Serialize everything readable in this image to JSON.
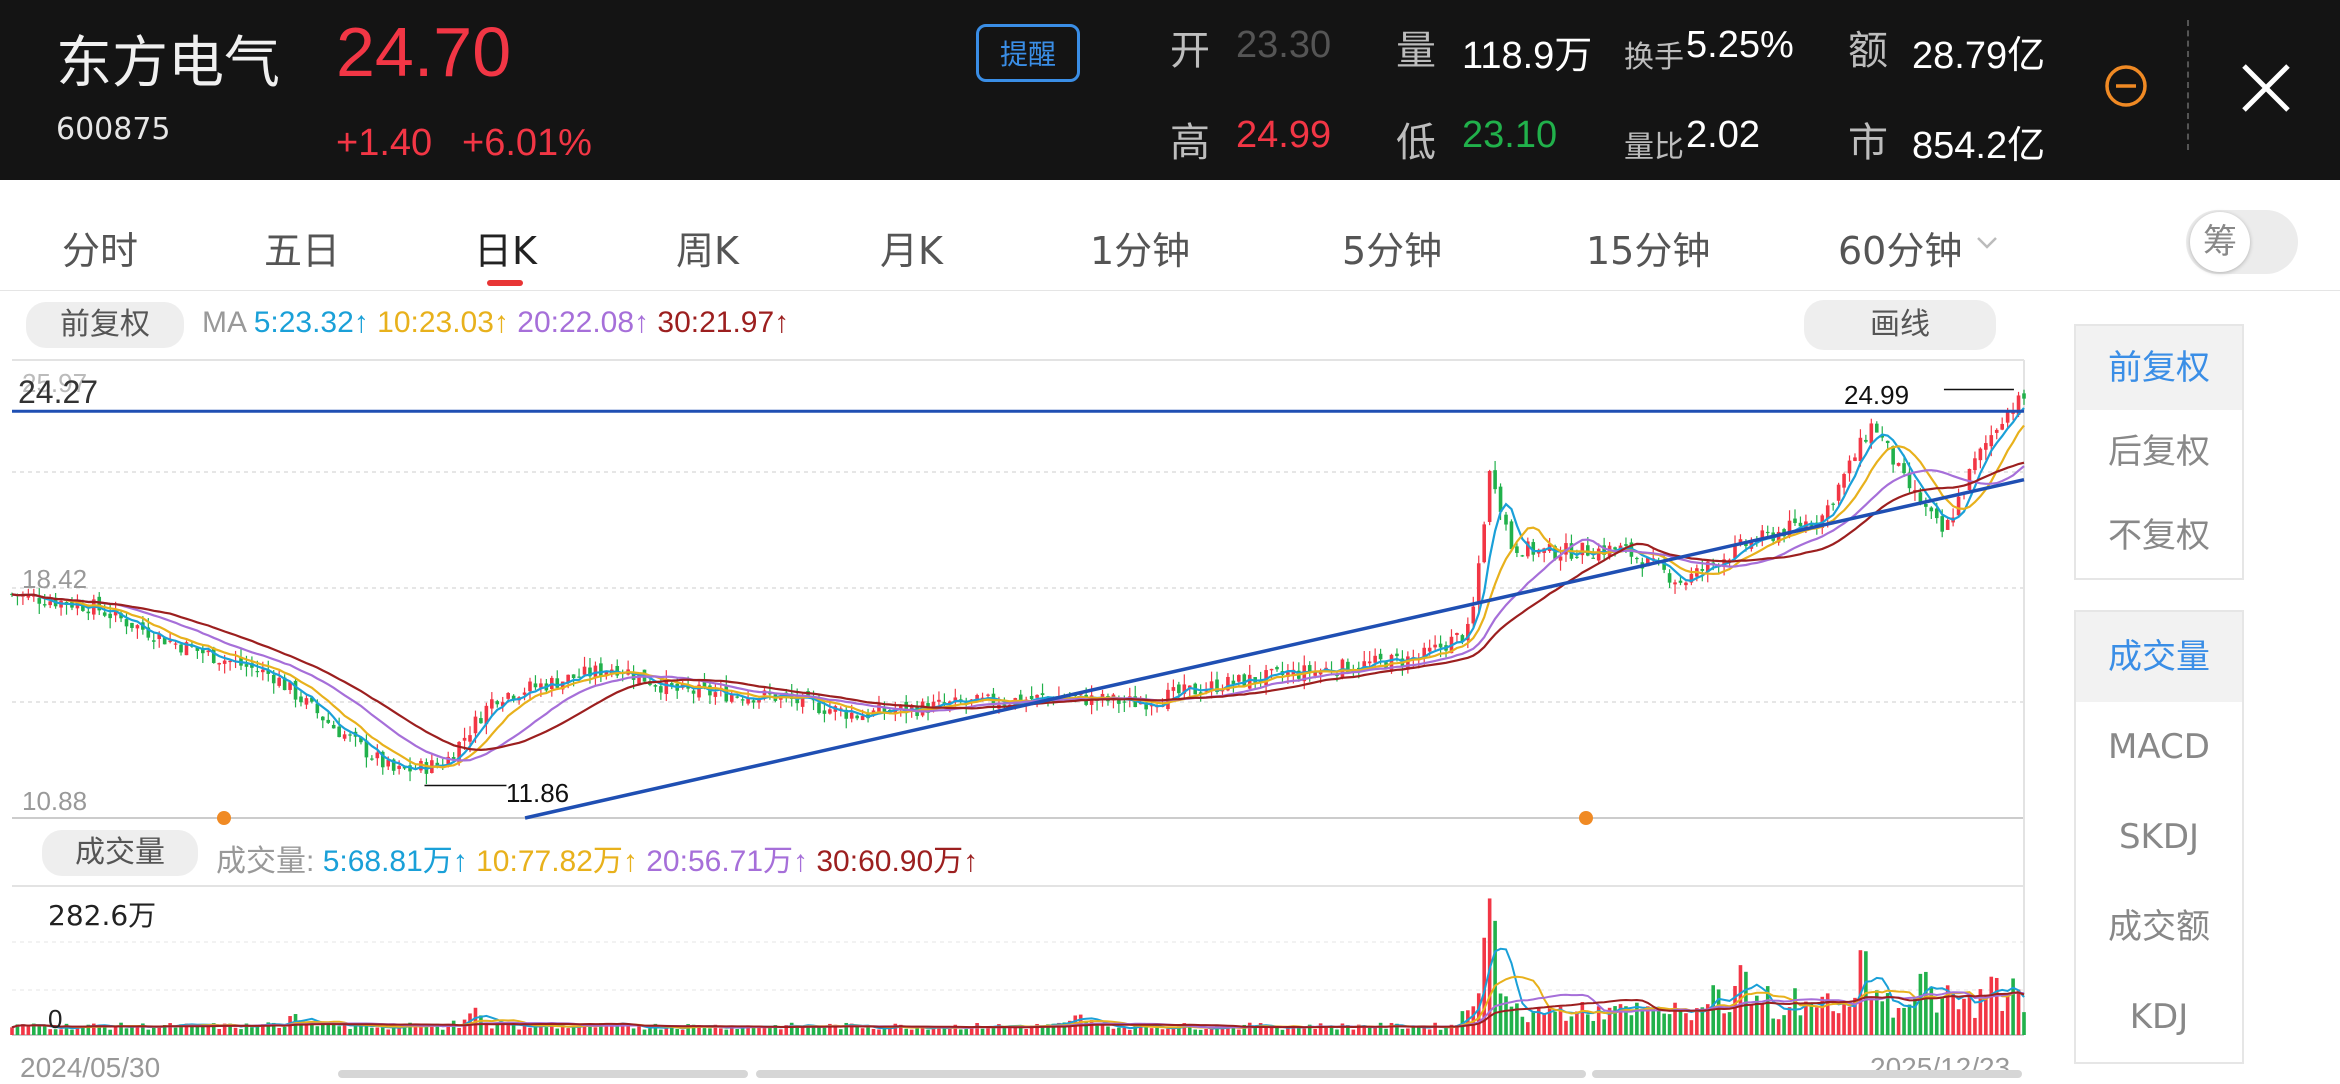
{
  "header": {
    "name": "东方电气",
    "code": "600875",
    "price": "24.70",
    "change": "+1.40",
    "change_pct": "+6.01%",
    "remind_label": "提醒",
    "stats": {
      "open_label": "开",
      "open": "23.30",
      "volume_label": "量",
      "volume": "118.9万",
      "turnover_label": "换手",
      "turnover": "5.25%",
      "amount_label": "额",
      "amount": "28.79亿",
      "high_label": "高",
      "high": "24.99",
      "low_label": "低",
      "low": "23.10",
      "vol_ratio_label": "量比",
      "vol_ratio": "2.02",
      "mktcap_label": "市",
      "mktcap": "854.2亿"
    },
    "colors": {
      "up": "#f23645",
      "down": "#21b14b",
      "accent": "#3a8ee6"
    }
  },
  "tabs": [
    {
      "label": "分时"
    },
    {
      "label": "五日"
    },
    {
      "label": "日K"
    },
    {
      "label": "周K"
    },
    {
      "label": "月K"
    },
    {
      "label": "1分钟"
    },
    {
      "label": "5分钟"
    },
    {
      "label": "15分钟"
    },
    {
      "label": "60分钟"
    }
  ],
  "active_tab": "日K",
  "chip_label": "筹",
  "chart_toolbar": {
    "adjust_label": "前复权",
    "draw_label": "画线",
    "ma_prefix": "MA",
    "ma": [
      {
        "text": "5:23.32↑",
        "color": "#1aa0d8"
      },
      {
        "text": "10:23.03↑",
        "color": "#e8b11c"
      },
      {
        "text": "20:22.08↑",
        "color": "#a66fd9"
      },
      {
        "text": "30:21.97↑",
        "color": "#9c1f1f"
      }
    ]
  },
  "price_chart": {
    "axis_labels": {
      "top": "25.97",
      "mid": "18.42",
      "bottom": "10.88"
    },
    "hline_label": "24.27",
    "high_label": "24.99",
    "low_label": "11.86"
  },
  "volume_panel": {
    "pill_label": "成交量",
    "prefix": "成交量:",
    "ma": [
      {
        "text": "5:68.81万↑",
        "color": "#1aa0d8"
      },
      {
        "text": "10:77.82万↑",
        "color": "#e8b11c"
      },
      {
        "text": "20:56.71万↑",
        "color": "#a66fd9"
      },
      {
        "text": "30:60.90万↑",
        "color": "#9c1f1f"
      }
    ],
    "max_label": "282.6万",
    "zero_label": "0"
  },
  "dates": {
    "start": "2024/05/30",
    "end": "2025/12/23"
  },
  "side_adjust": [
    {
      "label": "前复权",
      "active": true
    },
    {
      "label": "后复权",
      "active": false
    },
    {
      "label": "不复权",
      "active": false
    }
  ],
  "side_indicators": [
    {
      "label": "成交量",
      "active": true
    },
    {
      "label": "MACD",
      "active": false
    },
    {
      "label": "SKDJ",
      "active": false
    },
    {
      "label": "成交额",
      "active": false
    },
    {
      "label": "KDJ",
      "active": false
    }
  ],
  "chart_data": {
    "type": "candlestick",
    "title": "",
    "xrange": [
      "2024/05/30",
      "2025/12/23"
    ],
    "price_range": [
      10.88,
      25.97
    ],
    "gridline_labels": [
      25.97,
      18.42,
      10.88
    ],
    "annotations": {
      "hline": 24.27,
      "period_high": 24.99,
      "period_low": 11.86
    },
    "close_path": [
      [
        0,
        18.2
      ],
      [
        0.04,
        17.8
      ],
      [
        0.08,
        16.6
      ],
      [
        0.13,
        15.5
      ],
      [
        0.16,
        13.8
      ],
      [
        0.19,
        12.3
      ],
      [
        0.215,
        12.6
      ],
      [
        0.24,
        14.8
      ],
      [
        0.3,
        15.8
      ],
      [
        0.33,
        15.0
      ],
      [
        0.38,
        14.8
      ],
      [
        0.42,
        14.2
      ],
      [
        0.46,
        14.5
      ],
      [
        0.52,
        14.8
      ],
      [
        0.56,
        14.6
      ],
      [
        0.6,
        15.2
      ],
      [
        0.64,
        15.6
      ],
      [
        0.7,
        16.1
      ],
      [
        0.725,
        17.0
      ],
      [
        0.735,
        22.5
      ],
      [
        0.745,
        19.8
      ],
      [
        0.76,
        19.6
      ],
      [
        0.8,
        19.7
      ],
      [
        0.83,
        18.6
      ],
      [
        0.86,
        19.8
      ],
      [
        0.9,
        20.8
      ],
      [
        0.925,
        23.9
      ],
      [
        0.94,
        22.0
      ],
      [
        0.96,
        20.2
      ],
      [
        0.975,
        22.5
      ],
      [
        0.99,
        24.2
      ],
      [
        1.0,
        24.7
      ]
    ],
    "volume_range": [
      0,
      282.6
    ],
    "volume_unit": "万",
    "volume_spikes": [
      [
        0.14,
        45
      ],
      [
        0.23,
        55
      ],
      [
        0.53,
        45
      ],
      [
        0.735,
        282.6
      ],
      [
        0.86,
        150
      ],
      [
        0.92,
        190
      ],
      [
        0.95,
        140
      ],
      [
        0.985,
        130
      ],
      [
        0.995,
        115
      ]
    ]
  }
}
